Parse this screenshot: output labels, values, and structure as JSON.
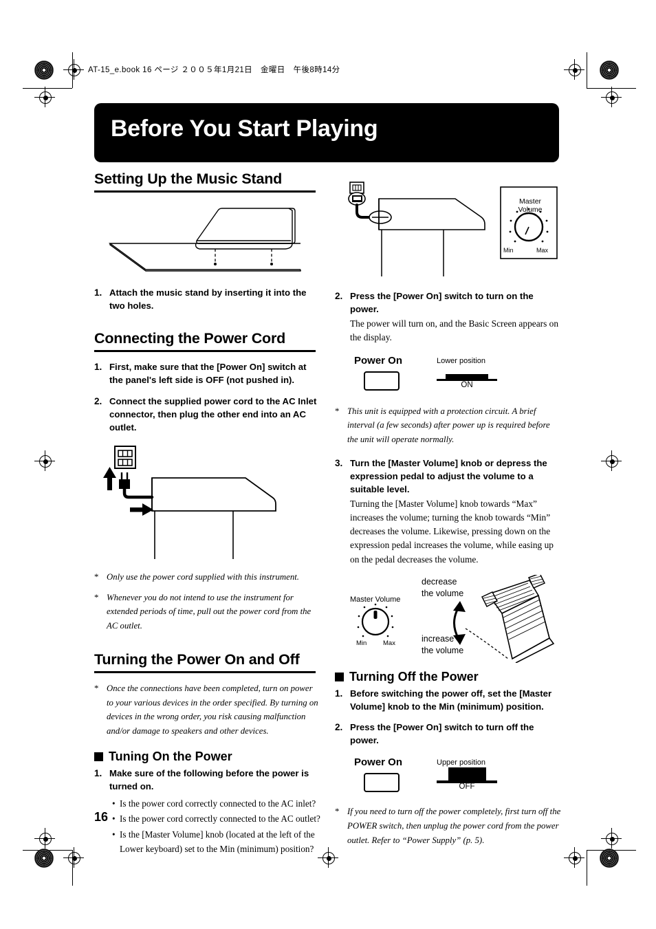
{
  "header": {
    "file_info": "AT-15_e.book 16 ページ ２００５年1月21日　金曜日　午後8時14分"
  },
  "title": "Before You Start Playing",
  "page_number": "16",
  "left_column": {
    "section1": {
      "heading": "Setting Up the Music Stand",
      "figure_name": "music-stand-illustration",
      "steps": [
        {
          "num": "1.",
          "text": "Attach the music stand by inserting it into the two holes."
        }
      ]
    },
    "section2": {
      "heading": "Connecting the Power Cord",
      "steps": [
        {
          "num": "1.",
          "text": "First, make sure that the [Power On] switch at the panel's left side is OFF (not pushed in)."
        },
        {
          "num": "2.",
          "text": "Connect the supplied power cord to the AC Inlet connector, then plug the other end into an AC outlet."
        }
      ],
      "figure_name": "power-cord-connection-illustration",
      "notes": [
        "Only use the power cord supplied with this instrument.",
        "Whenever you do not intend to use the instrument for extended periods of time, pull out the power cord from the AC outlet."
      ]
    },
    "section3": {
      "heading": "Turning the Power On and Off",
      "notes": [
        "Once the connections have been completed, turn on power to your various devices in the order specified. By turning on devices in the wrong order, you risk causing malfunction and/or damage to speakers and other devices."
      ],
      "subheading": "Tuning On the Power",
      "steps": [
        {
          "num": "1.",
          "text": "Make sure of the following before the power is turned on."
        }
      ],
      "bullets": [
        "Is the power cord correctly connected to the AC inlet?",
        "Is the power cord correctly connected to the AC outlet?",
        "Is the [Master Volume] knob (located at the left of the Lower keyboard) set to the Min (minimum) position?"
      ]
    }
  },
  "right_column": {
    "figure_top": {
      "name": "organ-power-connection-illustration",
      "knob_panel": {
        "title": "Master Volume",
        "min_label": "Min",
        "max_label": "Max"
      }
    },
    "step2": {
      "num": "2.",
      "text": "Press the [Power On] switch to turn on the power.",
      "body": "The power will turn on, and the Basic Screen appears on the display."
    },
    "power_on_figure": {
      "label": "Power On",
      "position_label": "Lower position",
      "state": "ON"
    },
    "note_protection": "This unit is equipped with a protection circuit. A brief interval (a few seconds) after power up is required before the unit will operate normally.",
    "step3": {
      "num": "3.",
      "text": "Turn the [Master Volume] knob or depress the expression pedal to adjust the volume to a suitable level.",
      "body": "Turning the [Master Volume] knob towards “Max” increases the volume; turning the knob towards “Min” decreases the volume. Likewise, pressing down on the expression pedal increases the volume, while easing up on the pedal decreases the volume."
    },
    "pedal_figure": {
      "name": "expression-pedal-illustration",
      "knob_title": "Master Volume",
      "min_label": "Min",
      "max_label": "Max",
      "decrease_label_line1": "decrease",
      "decrease_label_line2": "the volume",
      "increase_label_line1": "increase",
      "increase_label_line2": "the volume"
    },
    "section_off": {
      "subheading": "Turning Off the Power",
      "steps": [
        {
          "num": "1.",
          "text": "Before switching the power off, set the [Master Volume] knob to the Min (minimum) position."
        },
        {
          "num": "2.",
          "text": "Press the [Power On] switch to turn off the power."
        }
      ],
      "power_off_figure": {
        "label": "Power On",
        "position_label": "Upper position",
        "state": "OFF"
      },
      "note": "If you need to turn off the power completely, first turn off the POWER switch, then unplug the power cord from the power outlet. Refer to “Power Supply” (p. 5)."
    }
  }
}
